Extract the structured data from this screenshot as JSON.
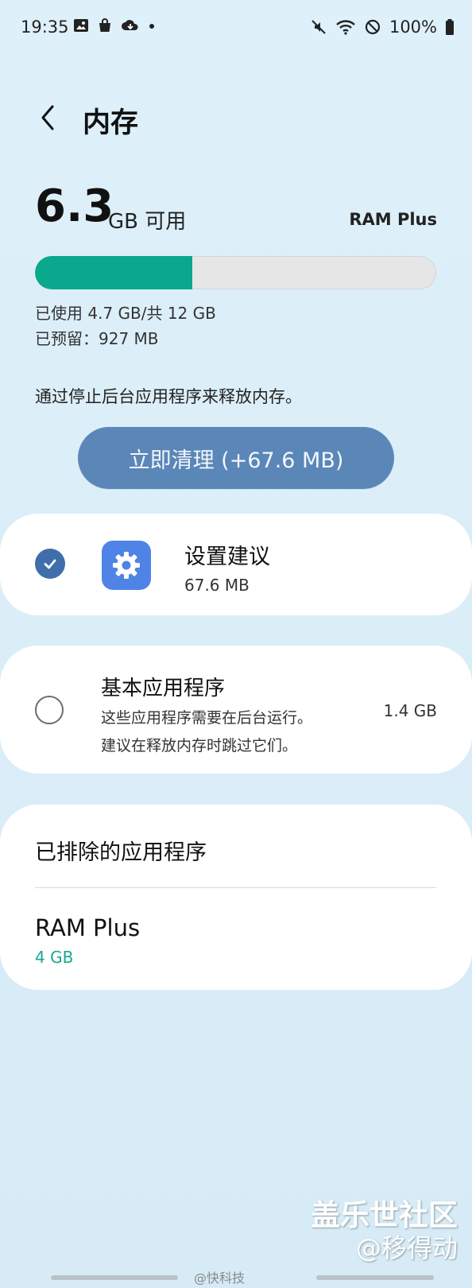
{
  "status_bar": {
    "time": "19:35",
    "battery": "100%",
    "icons_left": [
      "image-icon",
      "bag-icon",
      "cloud-icon",
      "dot-icon"
    ],
    "icons_right": [
      "mute-icon",
      "wifi-icon",
      "blocked-icon",
      "battery-icon"
    ]
  },
  "header": {
    "title": "内存"
  },
  "memory": {
    "available_value": "6.3",
    "available_suffix": "GB 可用",
    "ram_plus_label": "RAM Plus",
    "used_label": "已使用 4.7 GB/共 12 GB",
    "reserved_label": "已预留：927 MB",
    "used_fraction": 0.392,
    "description": "通过停止后台应用程序来释放内存。",
    "clean_button": "立即清理 (+67.6 MB)"
  },
  "cards": {
    "suggested": {
      "title": "设置建议",
      "size": "67.6 MB",
      "checked": true
    },
    "essential": {
      "title": "基本应用程序",
      "desc_line1": "这些应用程序需要在后台运行。",
      "desc_line2": "建议在释放内存时跳过它们。",
      "size": "1.4 GB",
      "checked": false
    },
    "excluded": {
      "title": "已排除的应用程序",
      "ram_plus_title": "RAM Plus",
      "ram_plus_value": "4 GB"
    }
  },
  "watermarks": {
    "line1": "盖乐世社区",
    "line2": "@移得动",
    "line3": "@快科技"
  },
  "colors": {
    "accent_teal": "#0aa88c",
    "button_blue": "#5b86b8",
    "check_blue": "#3f6eaa",
    "value_green": "#18a88e"
  }
}
